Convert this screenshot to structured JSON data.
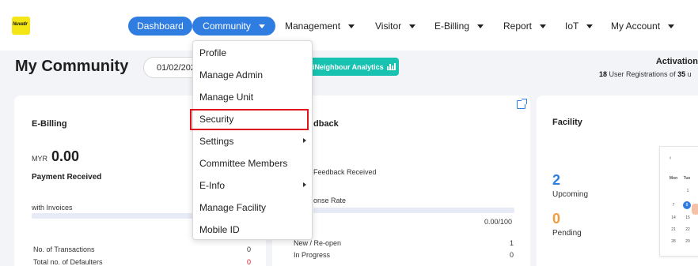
{
  "nav": {
    "logo_text": "Nuvatir",
    "items": [
      {
        "label": "Dashboard"
      },
      {
        "label": "Community"
      },
      {
        "label": "Management"
      },
      {
        "label": "Visitor"
      },
      {
        "label": "E-Billing"
      },
      {
        "label": "Report"
      },
      {
        "label": "IoT"
      },
      {
        "label": "My Account"
      }
    ],
    "colors": {
      "active_pill": "#2f7de1"
    }
  },
  "header": {
    "title": "My Community",
    "date": "01/02/2025",
    "analytics_button": "iNeighbour Analytics",
    "activation_title": "Activation",
    "activation_count": "18",
    "activation_text": "User Registrations of",
    "activation_total": "35",
    "activation_tail": "u"
  },
  "dropdown": {
    "items": [
      {
        "label": "Profile",
        "has_submenu": false
      },
      {
        "label": "Manage Admin",
        "has_submenu": false
      },
      {
        "label": "Manage Unit",
        "has_submenu": false
      },
      {
        "label": "Security",
        "has_submenu": false
      },
      {
        "label": "Settings",
        "has_submenu": true
      },
      {
        "label": "Committee Members",
        "has_submenu": false
      },
      {
        "label": "E-Info",
        "has_submenu": true
      },
      {
        "label": "Manage Facility",
        "has_submenu": false
      },
      {
        "label": "Mobile ID",
        "has_submenu": false
      }
    ],
    "highlighted": "Security",
    "highlight_color": "#e0121d"
  },
  "ebilling": {
    "title": "E-Billing",
    "currency": "MYR",
    "amount": "0.00",
    "payment_label": "Payment Received",
    "invoices_label": "with Invoices",
    "transactions_label": "No. of Transactions",
    "transactions_value": "0",
    "defaulters_label": "Total no. of Defaulters",
    "defaulters_value": "0"
  },
  "feedback": {
    "title": "dback",
    "received_label": "Feedback Received",
    "response_label": "onse Rate",
    "rate_value": "0.00/100",
    "rows": [
      {
        "label": "New / Re-open",
        "value": "1"
      },
      {
        "label": "In Progress",
        "value": "0"
      }
    ]
  },
  "facility": {
    "title": "Facility",
    "upcoming_value": "2",
    "upcoming_label": "Upcoming",
    "pending_value": "0",
    "pending_label": "Pending",
    "colors": {
      "upcoming": "#2f7de1",
      "pending": "#f39c3d"
    },
    "calendar": {
      "nav": "‹",
      "days": [
        "Mon",
        "Tue"
      ],
      "rows": [
        [
          "",
          "1"
        ],
        [
          "7",
          "8"
        ],
        [
          "14",
          "15"
        ],
        [
          "21",
          "22"
        ],
        [
          "28",
          "29"
        ]
      ],
      "selected": "8"
    }
  }
}
